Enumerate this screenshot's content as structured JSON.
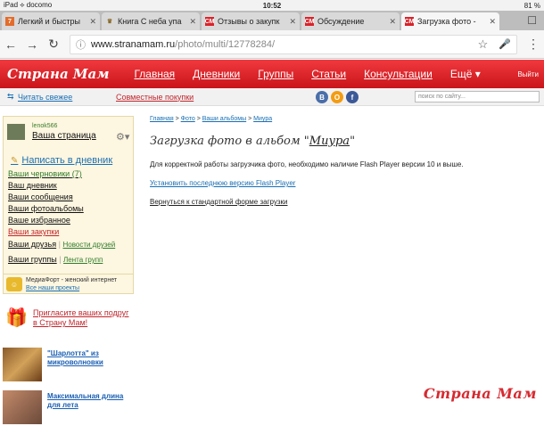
{
  "status": {
    "carrier": "iPad ⟡ docomo",
    "time": "10:52",
    "battery": "81 %"
  },
  "tabs": [
    {
      "label": "Легкий и быстры",
      "fav": "7",
      "color": "#e36d2c"
    },
    {
      "label": "Книга С неба упа",
      "fav": "👑",
      "color": "#888"
    },
    {
      "label": "Отзывы о закупк",
      "fav": "СМ",
      "color": "#d9232a"
    },
    {
      "label": "Обсуждение",
      "fav": "СМ",
      "color": "#d9232a"
    },
    {
      "label": "Загрузка фото -",
      "fav": "СМ",
      "color": "#d9232a",
      "active": true
    }
  ],
  "address": {
    "host": "www.stranamam.ru",
    "path": "/photo/multi/12778284/"
  },
  "site": {
    "logo": "Страна Мам",
    "menu": [
      "Главная",
      "Дневники",
      "Группы",
      "Статьи",
      "Консультации",
      "Ещё ▾"
    ],
    "exit": "Выйти",
    "read_fresh": "Читать свежее",
    "joint_purchases": "Совместные покупки",
    "search_placeholder": "поиск по сайту...",
    "social": [
      {
        "t": "В",
        "c": "#4a6ea9"
      },
      {
        "t": "О",
        "c": "#f39c12"
      },
      {
        "t": "f",
        "c": "#3b5998"
      }
    ]
  },
  "sidebar": {
    "username": "lenok566",
    "my_page": "Ваша страница",
    "write_diary": "Написать в дневник",
    "drafts": "Ваши черновики",
    "drafts_count": "(7)",
    "links": [
      "Ваш дневник",
      "Ваши сообщения",
      "Ваши фотоальбомы",
      "Ваше избранное"
    ],
    "purchases": "Ваши закупки",
    "friends": "Ваши друзья",
    "friends_news": "Новости друзей",
    "groups": "Ваши группы",
    "groups_feed": "Лента групп",
    "mediafort": "МедиаФорт - женский интернет",
    "all_projects": "Все наши проекты"
  },
  "invite": "Пригласите ваших подруг в Страну Мам!",
  "ads": [
    "\"Шарлотта\" из микроволновки",
    "Максимальная длина для лета"
  ],
  "main": {
    "breadcrumbs": [
      "Главная",
      "Фото",
      "Ваши альбомы",
      "Миура"
    ],
    "title_prefix": "Загрузка фото в альбом \"",
    "album": "Миура",
    "title_suffix": "\"",
    "info": "Для корректной работы загрузчика фото, необходимо наличие Flash Player версии 10 и выше.",
    "install_link": "Установить последнюю версию Flash Player",
    "back_link": "Вернуться к стандартной форме загрузки"
  },
  "watermark": "Страна Мам"
}
